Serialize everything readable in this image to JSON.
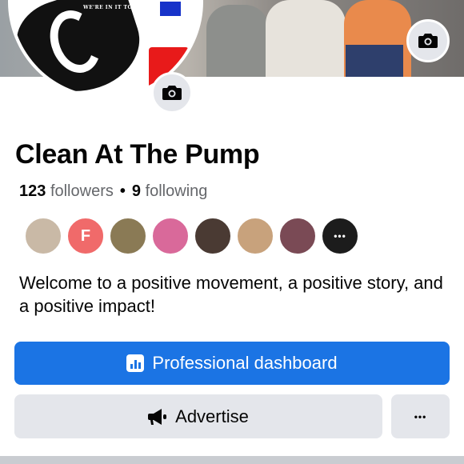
{
  "profile": {
    "name": "Clean At The Pump",
    "followers_count": "123",
    "followers_label": "followers",
    "separator": "•",
    "following_count": "9",
    "following_label": "following",
    "avatar_logo_text": "WE'RE IN IT TOGETHER",
    "bio": "Welcome to a positive movement, a positive story, and a positive impact!"
  },
  "followers_preview": [
    {
      "initial": "",
      "color": "#c9b9a6"
    },
    {
      "initial": "F",
      "color": "#f06a6a"
    },
    {
      "initial": "",
      "color": "#8a7a55"
    },
    {
      "initial": "",
      "color": "#d9699a"
    },
    {
      "initial": "",
      "color": "#4a3a33"
    },
    {
      "initial": "",
      "color": "#c8a27c"
    },
    {
      "initial": "",
      "color": "#7a4a55"
    }
  ],
  "followers_more": "•••",
  "actions": {
    "primary_label": "Professional dashboard",
    "secondary_label": "Advertise",
    "more_label": "•••"
  },
  "icons": {
    "cover_camera": "camera-icon",
    "avatar_camera": "camera-icon",
    "dashboard": "bar-chart-icon",
    "advertise": "megaphone-icon",
    "more": "more-horizontal-icon"
  },
  "colors": {
    "primary": "#1b74e4",
    "secondary_bg": "#e4e6eb",
    "muted_text": "#65676b"
  }
}
